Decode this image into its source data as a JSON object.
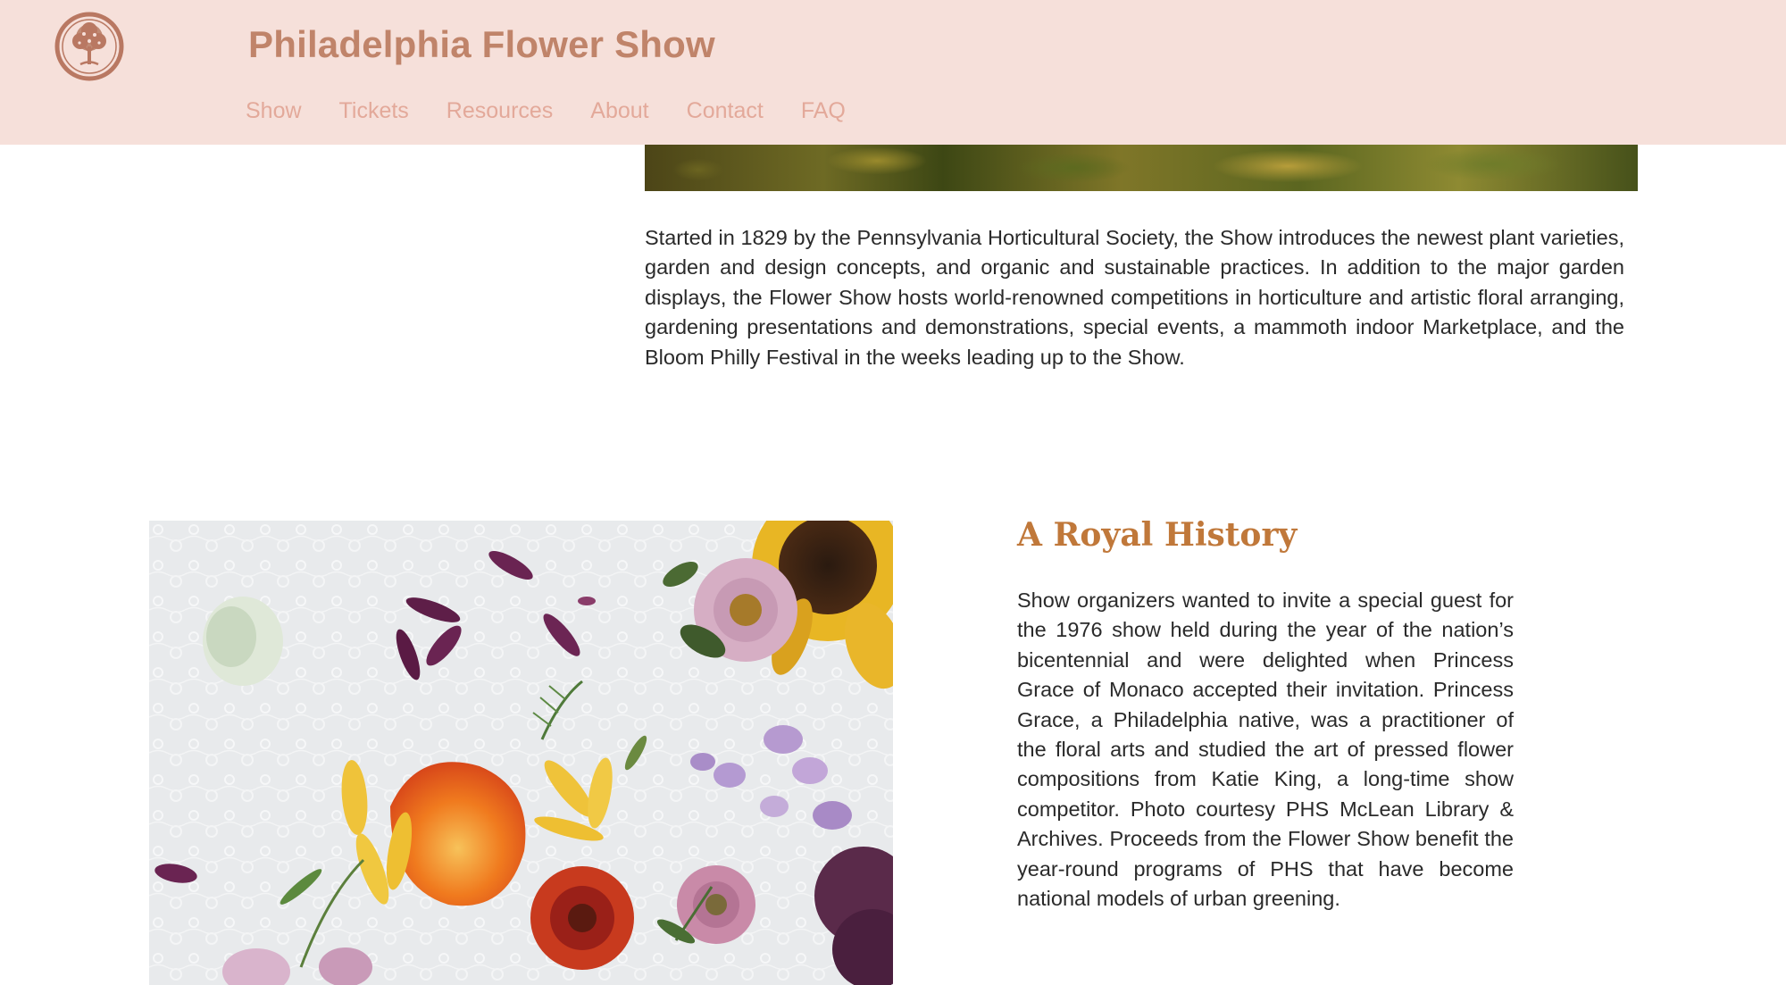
{
  "header": {
    "site_title": "Philadelphia Flower Show",
    "logo_icon": "tree-icon",
    "nav": [
      {
        "label": "Show"
      },
      {
        "label": "Tickets"
      },
      {
        "label": "Resources"
      },
      {
        "label": "About"
      },
      {
        "label": "Contact"
      },
      {
        "label": "FAQ"
      }
    ],
    "colors": {
      "background": "#f6e0da",
      "title": "#c0846a",
      "nav": "#e3a99a"
    }
  },
  "intro": {
    "text": "Started in 1829 by the Pennsylvania Horticultural Society, the Show introduces the newest plant varieties, garden and design concepts, and organic and sustainable practices. In addition to the major garden displays, the Flower Show hosts world-renowned competitions in horticulture and artistic floral arranging, gardening presentations and demonstrations, special events, a mammoth indoor Marketplace, and the Bloom Philly Festival in the weeks leading up to the Show."
  },
  "history": {
    "heading": "A Royal History",
    "text": "Show organizers wanted to invite a special guest for the 1976 show held during the year of the nation’s bicentennial and were delighted when Princess Grace of Monaco accepted their invitation. Princess Grace, a Philadelphia native, was a practitioner of the floral arts and studied the art of pressed flower compositions from Katie King, a long-time show competitor. Photo courtesy PHS McLean Library & Archives. Proceeds from the Flower Show benefit the year-round programs of PHS that have become national models of urban greening.",
    "heading_color": "#c0783a"
  }
}
